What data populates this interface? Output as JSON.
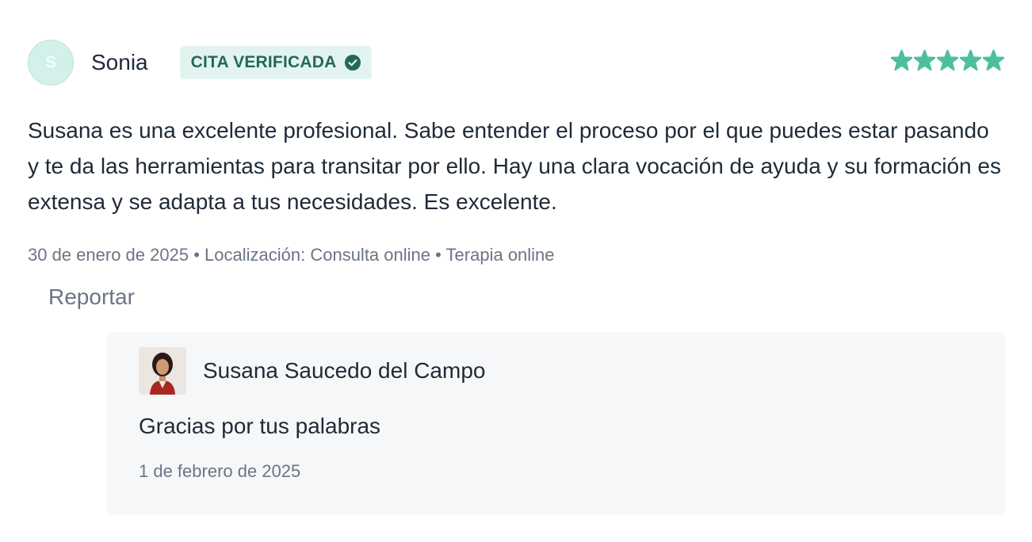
{
  "review": {
    "avatar_initial": "S",
    "reviewer_name": "Sonia",
    "badge_label": "CITA VERIFICADA",
    "badge_icon": "check-circle-icon",
    "rating": 5,
    "rating_max": 5,
    "star_icon": "star-icon",
    "comment": "Susana es una excelente profesional. Sabe entender el proceso por el que puedes estar pasando y te da las herramientas para transitar por ello. Hay una clara vocación de ayuda y su formación es extensa y se adapta a tus necesidades. Es excelente.",
    "meta": {
      "date": "30 de enero de 2025",
      "separator": "•",
      "location": "Localización: Consulta online",
      "service": "Terapia online"
    },
    "report_label": "Reportar"
  },
  "reply": {
    "author_name": "Susana Saucedo del Campo",
    "text": "Gracias por tus palabras",
    "date": "1 de febrero de 2025"
  },
  "colors": {
    "accent": "#4dbf9e",
    "badge_bg": "#e3f4f0",
    "badge_text": "#22695b",
    "muted_text": "#6b7585",
    "reply_bg": "#f6f7f9"
  }
}
